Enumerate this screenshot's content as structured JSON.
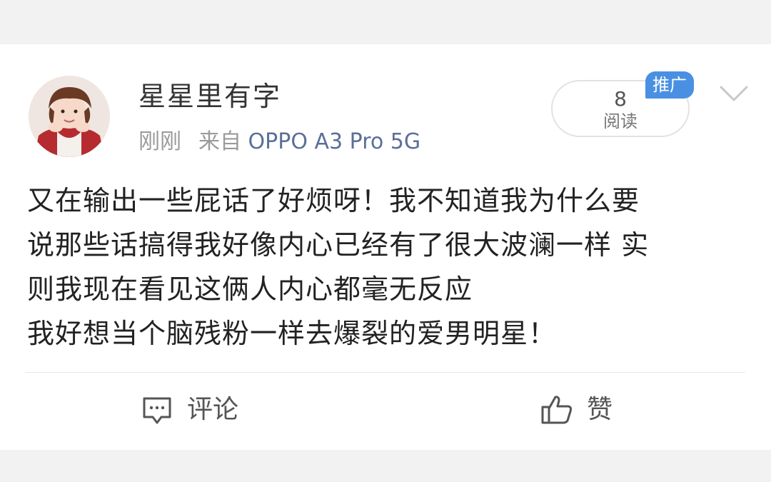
{
  "post": {
    "author": {
      "name": "星星里有字",
      "avatar": "avatar"
    },
    "meta": {
      "time": "刚刚",
      "source_prefix": "来自",
      "device": "OPPO A3 Pro 5G"
    },
    "read": {
      "count": "8",
      "label": "阅读"
    },
    "badge": "推广",
    "body_lines": [
      "又在输出一些屁话了好烦呀！我不知道我为什么要",
      "说那些话搞得我好像内心已经有了很大波澜一样 实",
      "则我现在看见这俩人内心都毫无反应",
      "我好想当个脑残粉一样去爆裂的爱男明星！"
    ]
  },
  "actions": {
    "comment": {
      "label": "评论",
      "icon": "comment-icon"
    },
    "like": {
      "label": "赞",
      "icon": "thumbs-up-icon"
    }
  },
  "colors": {
    "background": "#f2f2f2",
    "card": "#ffffff",
    "badge": "#4a90e2",
    "device_link": "#5a6f99",
    "text_primary": "#222222",
    "text_secondary": "#9a9a9a"
  }
}
